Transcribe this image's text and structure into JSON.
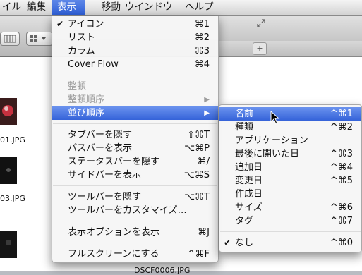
{
  "menubar": {
    "items": [
      {
        "label": "イル"
      },
      {
        "label": "編集"
      },
      {
        "label": "表示"
      },
      {
        "label": "移動"
      },
      {
        "label": "ウインドウ"
      },
      {
        "label": "ヘルプ"
      }
    ]
  },
  "finder": {
    "files": [
      "01.JPG",
      "03.JPG",
      "DSCF0006.JPG"
    ],
    "tab_plus": "+"
  },
  "view_menu": {
    "items": [
      {
        "label": "アイコン",
        "shortcut": "⌘1",
        "checked": "✔"
      },
      {
        "label": "リスト",
        "shortcut": "⌘2"
      },
      {
        "label": "カラム",
        "shortcut": "⌘3"
      },
      {
        "label": "Cover Flow",
        "shortcut": "⌘4"
      },
      {
        "label": "整頓"
      },
      {
        "label": "整頓順序"
      },
      {
        "label": "並び順序"
      },
      {
        "label": "タブバーを隠す",
        "shortcut": "⇧⌘T"
      },
      {
        "label": "パスバーを表示",
        "shortcut": "⌥⌘P"
      },
      {
        "label": "ステータスバーを隠す",
        "shortcut": "⌘/"
      },
      {
        "label": "サイドバーを表示",
        "shortcut": "⌥⌘S"
      },
      {
        "label": "ツールバーを隠す",
        "shortcut": "⌥⌘T"
      },
      {
        "label": "ツールバーをカスタマイズ…"
      },
      {
        "label": "表示オプションを表示",
        "shortcut": "⌘J"
      },
      {
        "label": "フルスクリーンにする",
        "shortcut": "^⌘F"
      }
    ],
    "arrow": "▶"
  },
  "sort_menu": {
    "items": [
      {
        "label": "名前",
        "shortcut": "^⌘1"
      },
      {
        "label": "種類",
        "shortcut": "^⌘2"
      },
      {
        "label": "アプリケーション"
      },
      {
        "label": "最後に開いた日",
        "shortcut": "^⌘3"
      },
      {
        "label": "追加日",
        "shortcut": "^⌘4"
      },
      {
        "label": "変更日",
        "shortcut": "^⌘5"
      },
      {
        "label": "作成日"
      },
      {
        "label": "サイズ",
        "shortcut": "^⌘6"
      },
      {
        "label": "タグ",
        "shortcut": "^⌘7"
      },
      {
        "label": "なし",
        "shortcut": "^⌘0",
        "checked": "✔"
      }
    ]
  }
}
